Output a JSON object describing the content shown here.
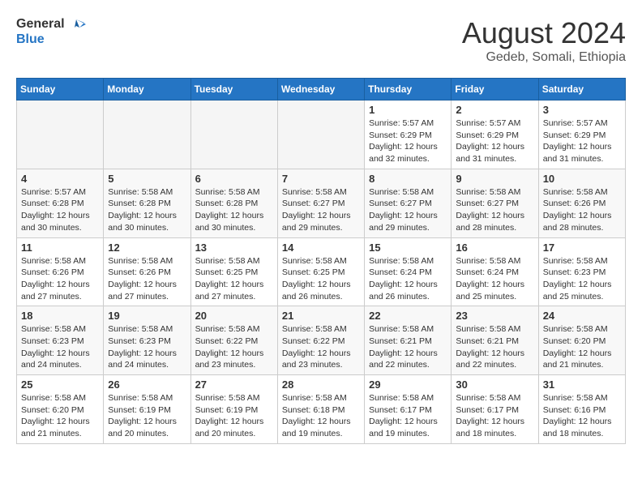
{
  "header": {
    "logo_line1": "General",
    "logo_line2": "Blue",
    "main_title": "August 2024",
    "subtitle": "Gedeb, Somali, Ethiopia"
  },
  "weekdays": [
    "Sunday",
    "Monday",
    "Tuesday",
    "Wednesday",
    "Thursday",
    "Friday",
    "Saturday"
  ],
  "weeks": [
    [
      {
        "day": "",
        "detail": ""
      },
      {
        "day": "",
        "detail": ""
      },
      {
        "day": "",
        "detail": ""
      },
      {
        "day": "",
        "detail": ""
      },
      {
        "day": "1",
        "detail": "Sunrise: 5:57 AM\nSunset: 6:29 PM\nDaylight: 12 hours\nand 32 minutes."
      },
      {
        "day": "2",
        "detail": "Sunrise: 5:57 AM\nSunset: 6:29 PM\nDaylight: 12 hours\nand 31 minutes."
      },
      {
        "day": "3",
        "detail": "Sunrise: 5:57 AM\nSunset: 6:29 PM\nDaylight: 12 hours\nand 31 minutes."
      }
    ],
    [
      {
        "day": "4",
        "detail": "Sunrise: 5:57 AM\nSunset: 6:28 PM\nDaylight: 12 hours\nand 30 minutes."
      },
      {
        "day": "5",
        "detail": "Sunrise: 5:58 AM\nSunset: 6:28 PM\nDaylight: 12 hours\nand 30 minutes."
      },
      {
        "day": "6",
        "detail": "Sunrise: 5:58 AM\nSunset: 6:28 PM\nDaylight: 12 hours\nand 30 minutes."
      },
      {
        "day": "7",
        "detail": "Sunrise: 5:58 AM\nSunset: 6:27 PM\nDaylight: 12 hours\nand 29 minutes."
      },
      {
        "day": "8",
        "detail": "Sunrise: 5:58 AM\nSunset: 6:27 PM\nDaylight: 12 hours\nand 29 minutes."
      },
      {
        "day": "9",
        "detail": "Sunrise: 5:58 AM\nSunset: 6:27 PM\nDaylight: 12 hours\nand 28 minutes."
      },
      {
        "day": "10",
        "detail": "Sunrise: 5:58 AM\nSunset: 6:26 PM\nDaylight: 12 hours\nand 28 minutes."
      }
    ],
    [
      {
        "day": "11",
        "detail": "Sunrise: 5:58 AM\nSunset: 6:26 PM\nDaylight: 12 hours\nand 27 minutes."
      },
      {
        "day": "12",
        "detail": "Sunrise: 5:58 AM\nSunset: 6:26 PM\nDaylight: 12 hours\nand 27 minutes."
      },
      {
        "day": "13",
        "detail": "Sunrise: 5:58 AM\nSunset: 6:25 PM\nDaylight: 12 hours\nand 27 minutes."
      },
      {
        "day": "14",
        "detail": "Sunrise: 5:58 AM\nSunset: 6:25 PM\nDaylight: 12 hours\nand 26 minutes."
      },
      {
        "day": "15",
        "detail": "Sunrise: 5:58 AM\nSunset: 6:24 PM\nDaylight: 12 hours\nand 26 minutes."
      },
      {
        "day": "16",
        "detail": "Sunrise: 5:58 AM\nSunset: 6:24 PM\nDaylight: 12 hours\nand 25 minutes."
      },
      {
        "day": "17",
        "detail": "Sunrise: 5:58 AM\nSunset: 6:23 PM\nDaylight: 12 hours\nand 25 minutes."
      }
    ],
    [
      {
        "day": "18",
        "detail": "Sunrise: 5:58 AM\nSunset: 6:23 PM\nDaylight: 12 hours\nand 24 minutes."
      },
      {
        "day": "19",
        "detail": "Sunrise: 5:58 AM\nSunset: 6:23 PM\nDaylight: 12 hours\nand 24 minutes."
      },
      {
        "day": "20",
        "detail": "Sunrise: 5:58 AM\nSunset: 6:22 PM\nDaylight: 12 hours\nand 23 minutes."
      },
      {
        "day": "21",
        "detail": "Sunrise: 5:58 AM\nSunset: 6:22 PM\nDaylight: 12 hours\nand 23 minutes."
      },
      {
        "day": "22",
        "detail": "Sunrise: 5:58 AM\nSunset: 6:21 PM\nDaylight: 12 hours\nand 22 minutes."
      },
      {
        "day": "23",
        "detail": "Sunrise: 5:58 AM\nSunset: 6:21 PM\nDaylight: 12 hours\nand 22 minutes."
      },
      {
        "day": "24",
        "detail": "Sunrise: 5:58 AM\nSunset: 6:20 PM\nDaylight: 12 hours\nand 21 minutes."
      }
    ],
    [
      {
        "day": "25",
        "detail": "Sunrise: 5:58 AM\nSunset: 6:20 PM\nDaylight: 12 hours\nand 21 minutes."
      },
      {
        "day": "26",
        "detail": "Sunrise: 5:58 AM\nSunset: 6:19 PM\nDaylight: 12 hours\nand 20 minutes."
      },
      {
        "day": "27",
        "detail": "Sunrise: 5:58 AM\nSunset: 6:19 PM\nDaylight: 12 hours\nand 20 minutes."
      },
      {
        "day": "28",
        "detail": "Sunrise: 5:58 AM\nSunset: 6:18 PM\nDaylight: 12 hours\nand 19 minutes."
      },
      {
        "day": "29",
        "detail": "Sunrise: 5:58 AM\nSunset: 6:17 PM\nDaylight: 12 hours\nand 19 minutes."
      },
      {
        "day": "30",
        "detail": "Sunrise: 5:58 AM\nSunset: 6:17 PM\nDaylight: 12 hours\nand 18 minutes."
      },
      {
        "day": "31",
        "detail": "Sunrise: 5:58 AM\nSunset: 6:16 PM\nDaylight: 12 hours\nand 18 minutes."
      }
    ]
  ]
}
